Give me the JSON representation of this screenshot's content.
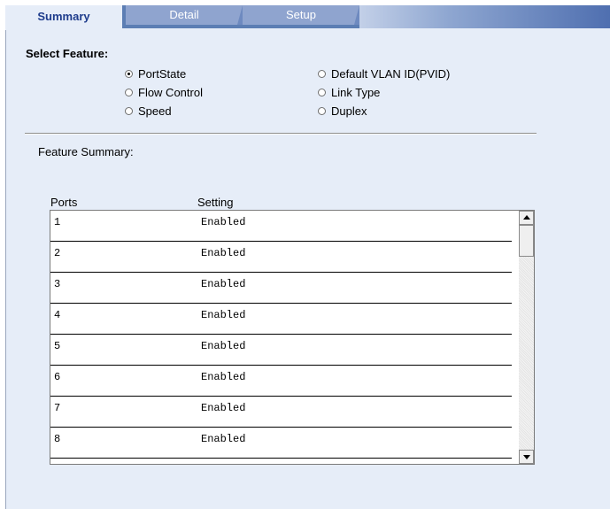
{
  "tabs": [
    {
      "label": "Summary",
      "active": true
    },
    {
      "label": "Detail",
      "active": false
    },
    {
      "label": "Setup",
      "active": false
    }
  ],
  "select_feature": {
    "title": "Select Feature:",
    "options": [
      {
        "label": "PortState",
        "checked": true
      },
      {
        "label": "Flow Control",
        "checked": false
      },
      {
        "label": "Speed",
        "checked": false
      },
      {
        "label": "Default VLAN ID(PVID)",
        "checked": false
      },
      {
        "label": "Link Type",
        "checked": false
      },
      {
        "label": "Duplex",
        "checked": false
      }
    ]
  },
  "feature_summary": {
    "title": "Feature Summary:",
    "columns": [
      "Ports",
      "Setting"
    ],
    "rows": [
      {
        "port": "1",
        "setting": "Enabled"
      },
      {
        "port": "2",
        "setting": "Enabled"
      },
      {
        "port": "3",
        "setting": "Enabled"
      },
      {
        "port": "4",
        "setting": "Enabled"
      },
      {
        "port": "5",
        "setting": "Enabled"
      },
      {
        "port": "6",
        "setting": "Enabled"
      },
      {
        "port": "7",
        "setting": "Enabled"
      },
      {
        "port": "8",
        "setting": "Enabled"
      }
    ]
  },
  "colors": {
    "panel_bg": "#e6edf8",
    "tab_active_text": "#1e3c8c",
    "tab_inactive_bg": "#8fa4cf",
    "header_band": "#4f6fb0"
  }
}
